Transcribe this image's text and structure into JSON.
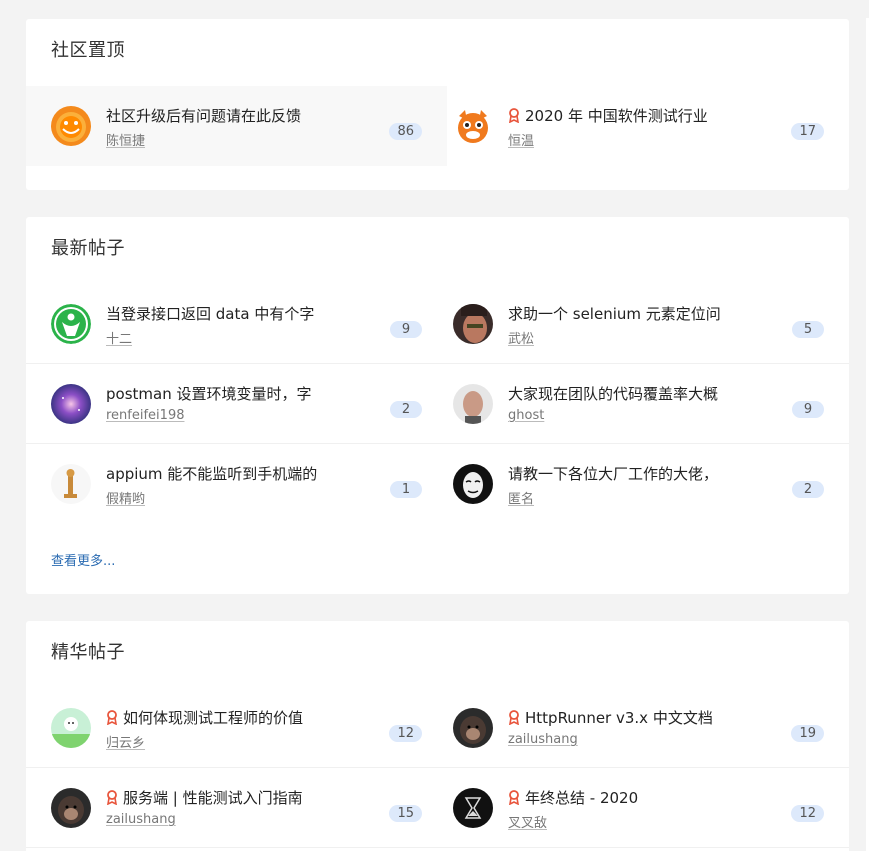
{
  "sections": {
    "pinned": {
      "title": "社区置顶",
      "topics": [
        {
          "title": "社区升级后有问题请在此反馈",
          "user": "陈恒捷",
          "count": "86",
          "award": false
        },
        {
          "title": "2020 年 中国软件测试行业",
          "user": "恒温",
          "count": "17",
          "award": true
        }
      ]
    },
    "latest": {
      "title": "最新帖子",
      "topics": [
        {
          "title": "当登录接口返回 data 中有个字",
          "user": "十二",
          "count": "9"
        },
        {
          "title": "求助一个 selenium 元素定位问",
          "user": "武松",
          "count": "5"
        },
        {
          "title": "postman 设置环境变量时，字",
          "user": "renfeifei198",
          "count": "2"
        },
        {
          "title": "大家现在团队的代码覆盖率大概",
          "user": "ghost",
          "count": "9"
        },
        {
          "title": "appium 能不能监听到手机端的",
          "user": "假精哟",
          "count": "1"
        },
        {
          "title": "请教一下各位大厂工作的大佬，",
          "user": "匿名",
          "count": "2"
        }
      ],
      "more": "查看更多..."
    },
    "excellent": {
      "title": "精华帖子",
      "topics": [
        {
          "title": "如何体现测试工程师的价值",
          "user": "归云乡",
          "count": "12"
        },
        {
          "title": "HttpRunner v3.x 中文文档",
          "user": "zailushang",
          "count": "19"
        },
        {
          "title": "服务端 | 性能测试入门指南",
          "user": "zailushang",
          "count": "15"
        },
        {
          "title": "年终总结 - 2020",
          "user": "叉叉敌",
          "count": "12"
        }
      ]
    }
  },
  "colors": {
    "background": "#f3f3f3",
    "card": "#ffffff",
    "badge": "#dde9fb",
    "link": "#2a6bb2",
    "award": "#e8553c"
  },
  "icons": {
    "award": "award-ribbon-icon"
  }
}
